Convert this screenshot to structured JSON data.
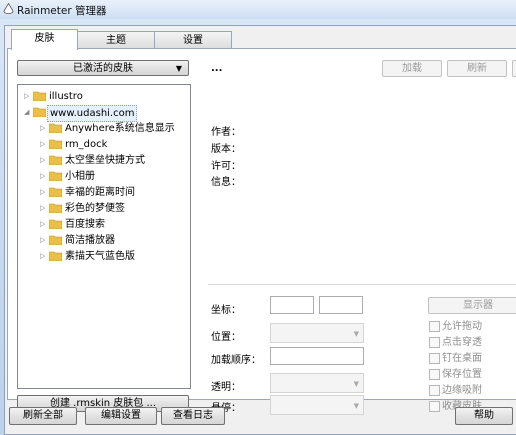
{
  "window": {
    "title": "Rainmeter 管理器"
  },
  "tabs": [
    {
      "label": "皮肤",
      "active": true
    },
    {
      "label": "主题",
      "active": false
    },
    {
      "label": "设置",
      "active": false
    }
  ],
  "skins_panel": {
    "dropdown_label": "已激活的皮肤",
    "tree": [
      {
        "label": "illustro",
        "level": 0,
        "expanded": false,
        "selected": false
      },
      {
        "label": "www.udashi.com",
        "level": 0,
        "expanded": true,
        "selected": true
      },
      {
        "label": "Anywhere系统信息显示",
        "level": 1
      },
      {
        "label": "rm_dock",
        "level": 1
      },
      {
        "label": "太空堡垒快捷方式",
        "level": 1
      },
      {
        "label": "小相册",
        "level": 1
      },
      {
        "label": "幸福的距离时间",
        "level": 1
      },
      {
        "label": "彩色的梦便签",
        "level": 1
      },
      {
        "label": "百度搜索",
        "level": 1
      },
      {
        "label": "简洁播放器",
        "level": 1
      },
      {
        "label": "素描天气蓝色版",
        "level": 1
      }
    ],
    "create_button": "创建 .rmskin 皮肤包 ..."
  },
  "details": {
    "skin_name": "...",
    "load_button": "加载",
    "refresh_button": "刷新",
    "author_label": "作者：",
    "version_label": "版本：",
    "license_label": "许可：",
    "info_label": "信息：",
    "coords_label": "坐标：",
    "position_label": "位置：",
    "load_order_label": "加载顺序：",
    "transparency_label": "透明：",
    "hover_label": "悬停：",
    "display_button": "显示器",
    "checkboxes": [
      "允许拖动",
      "点击穿透",
      "钉在桌面",
      "保存位置",
      "边缘吸附",
      "收藏皮肤"
    ]
  },
  "bottom_bar": {
    "refresh_all": "刷新全部",
    "edit_settings": "编辑设置",
    "view_log": "查看日志",
    "help": "帮助"
  }
}
